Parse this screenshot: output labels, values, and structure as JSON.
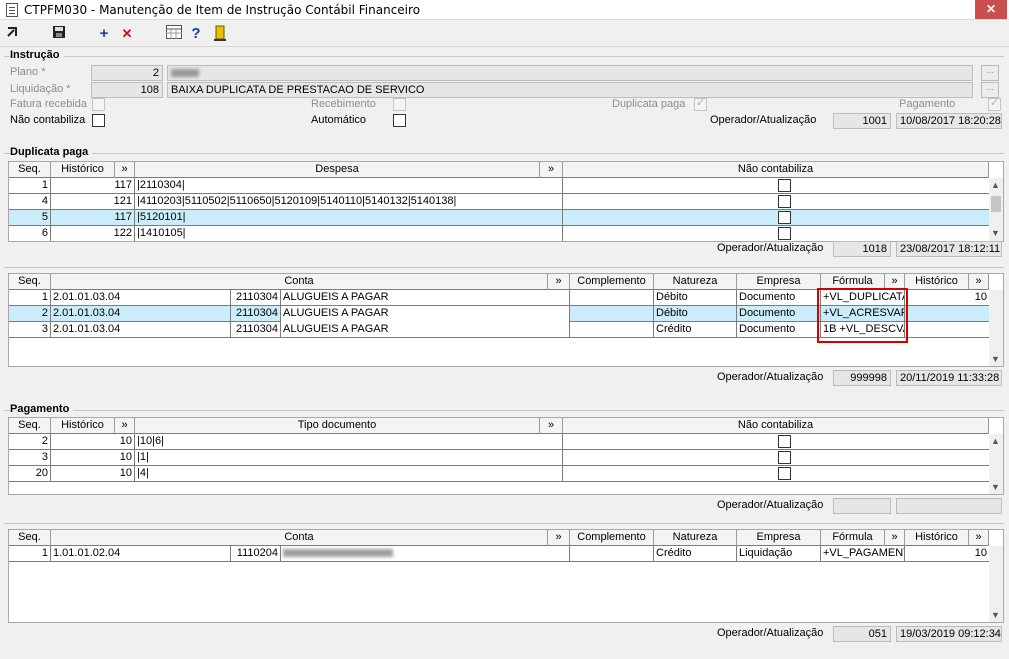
{
  "window": {
    "title": "CTPFM030 - Manutenção de Item de Instrução Contábil Financeiro",
    "close_glyph": "✕"
  },
  "toolbar": {
    "icons": [
      "exit-icon",
      "save-icon",
      "add-icon",
      "delete-icon",
      "calculator-icon",
      "help-icon",
      "door-exit-icon"
    ],
    "add_glyph": "+",
    "delete_glyph": "✕",
    "help_glyph": "?"
  },
  "instrucao": {
    "title": "Instrução",
    "plano_label": "Plano *",
    "plano_value": "2",
    "plano_desc": "",
    "liquidacao_label": "Liquidação *",
    "liquidacao_value": "108",
    "liquidacao_desc": "BAIXA DUPLICATA DE PRESTACAO DE SERVICO",
    "fatura_recebida_label": "Fatura recebida",
    "recebimento_label": "Recebimento",
    "duplicata_paga_label": "Duplicata paga",
    "pagamento_label": "Pagamento",
    "nao_contabiliza_label": "Não contabiliza",
    "automatico_label": "Automático",
    "operador_label": "Operador/Atualização",
    "operador_value": "1001",
    "atualizacao_value": "10/08/2017 18:20:28"
  },
  "duplicata_paga": {
    "title": "Duplicata paga",
    "headers": {
      "seq": "Seq.",
      "historico": "Histórico",
      "expand": "»",
      "despesa": "Despesa",
      "nao_contabiliza": "Não contabiliza"
    },
    "rows": [
      {
        "seq": "1",
        "historico": "117",
        "despesa": "|2110304|"
      },
      {
        "seq": "4",
        "historico": "121",
        "despesa": "|4110203|5110502|5110650|5120109|5140110|5140132|5140138|"
      },
      {
        "seq": "5",
        "historico": "117",
        "despesa": "|5120101|"
      },
      {
        "seq": "6",
        "historico": "122",
        "despesa": "|1410105|"
      }
    ],
    "operador_label": "Operador/Atualização",
    "operador_value": "1018",
    "atualizacao_value": "23/08/2017 18:12:11"
  },
  "contas_dup": {
    "headers": {
      "seq": "Seq.",
      "conta": "Conta",
      "expand": "»",
      "complemento": "Complemento",
      "natureza": "Natureza",
      "empresa": "Empresa",
      "formula": "Fórmula",
      "historico": "Histórico"
    },
    "rows": [
      {
        "seq": "1",
        "conta": "2.01.01.03.04",
        "codigo": "2110304",
        "descricao": "ALUGUEIS A PAGAR",
        "complemento": "",
        "natureza": "Débito",
        "empresa": "Documento",
        "formula": "+VL_DUPLICATA",
        "historico": "10"
      },
      {
        "seq": "2",
        "conta": "2.01.01.03.04",
        "codigo": "2110304",
        "descricao": "ALUGUEIS A PAGAR",
        "complemento": "",
        "natureza": "Débito",
        "empresa": "Documento",
        "formula": "+VL_ACRESVAR",
        "historico": ""
      },
      {
        "seq": "3",
        "conta": "2.01.01.03.04",
        "codigo": "2110304",
        "descricao": "ALUGUEIS A PAGAR",
        "complemento": "",
        "natureza": "Crédito",
        "empresa": "Documento",
        "formula": "1B +VL_DESCVA",
        "historico": ""
      }
    ],
    "operador_label": "Operador/Atualização",
    "operador_value": "999998",
    "atualizacao_value": "20/11/2019 11:33:28"
  },
  "pagamento": {
    "title": "Pagamento",
    "headers": {
      "seq": "Seq.",
      "historico": "Histórico",
      "expand": "»",
      "tipo_documento": "Tipo documento",
      "nao_contabiliza": "Não contabiliza"
    },
    "rows": [
      {
        "seq": "2",
        "historico": "10",
        "tipo": "|10|6|"
      },
      {
        "seq": "3",
        "historico": "10",
        "tipo": "|1|"
      },
      {
        "seq": "20",
        "historico": "10",
        "tipo": "|4|"
      }
    ],
    "operador_label": "Operador/Atualização",
    "operador_value": "",
    "atualizacao_value": ""
  },
  "contas_pag": {
    "headers": {
      "seq": "Seq.",
      "conta": "Conta",
      "expand": "»",
      "complemento": "Complemento",
      "natureza": "Natureza",
      "empresa": "Empresa",
      "formula": "Fórmula",
      "historico": "Histórico"
    },
    "rows": [
      {
        "seq": "1",
        "conta": "1.01.01.02.04",
        "codigo": "1110204",
        "descricao": "",
        "complemento": "",
        "natureza": "Crédito",
        "empresa": "Liquidação",
        "formula": "+VL_PAGAMENT",
        "historico": "10"
      }
    ],
    "operador_label": "Operador/Atualização",
    "operador_value": "051",
    "atualizacao_value": "19/03/2019 09:12:34"
  },
  "colors": {
    "selected_row": "#cbecfa",
    "highlight_box": "#d40000",
    "close_button": "#c94e4e"
  }
}
